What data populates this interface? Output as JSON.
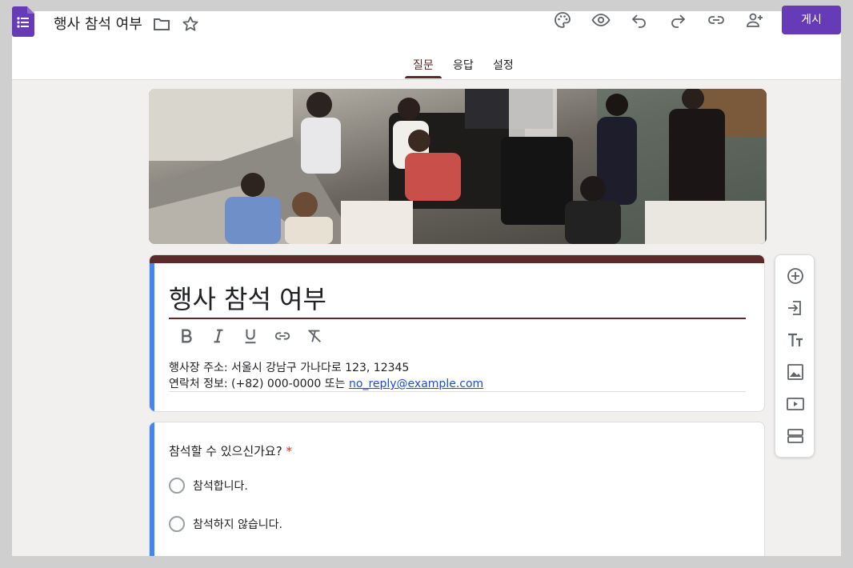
{
  "header": {
    "title": "행사 참석 여부",
    "publish_label": "게시",
    "icons": [
      "folder-icon",
      "star-icon",
      "palette-icon",
      "preview-icon",
      "undo-icon",
      "redo-icon",
      "link-icon",
      "add-collaborator-icon"
    ]
  },
  "tabs": [
    {
      "label": "질문",
      "active": true
    },
    {
      "label": "응답",
      "active": false
    },
    {
      "label": "설정",
      "active": false
    }
  ],
  "form": {
    "title": "행사 참석 여부",
    "format_buttons": [
      "bold-icon",
      "italic-icon",
      "underline-icon",
      "link-icon",
      "clear-format-icon"
    ],
    "description_line1": "행사장 주소: 서울시 강남구 가나다로 123, 12345",
    "description_line2_prefix": "연락처 정보: (+82) 000-0000 또는 ",
    "description_email": "no_reply@example.com"
  },
  "question": {
    "title": "참석할 수 있으신가요?",
    "required_mark": "*",
    "options": [
      "참석합니다.",
      "참석하지 않습니다."
    ]
  },
  "toolbar": [
    "add-question-icon",
    "import-questions-icon",
    "add-title-icon",
    "add-image-icon",
    "add-video-icon",
    "add-section-icon"
  ],
  "colors": {
    "accent": "#673ab7",
    "theme": "#5b2a2a",
    "focus_bar": "#4285f4",
    "required": "#d93025"
  }
}
